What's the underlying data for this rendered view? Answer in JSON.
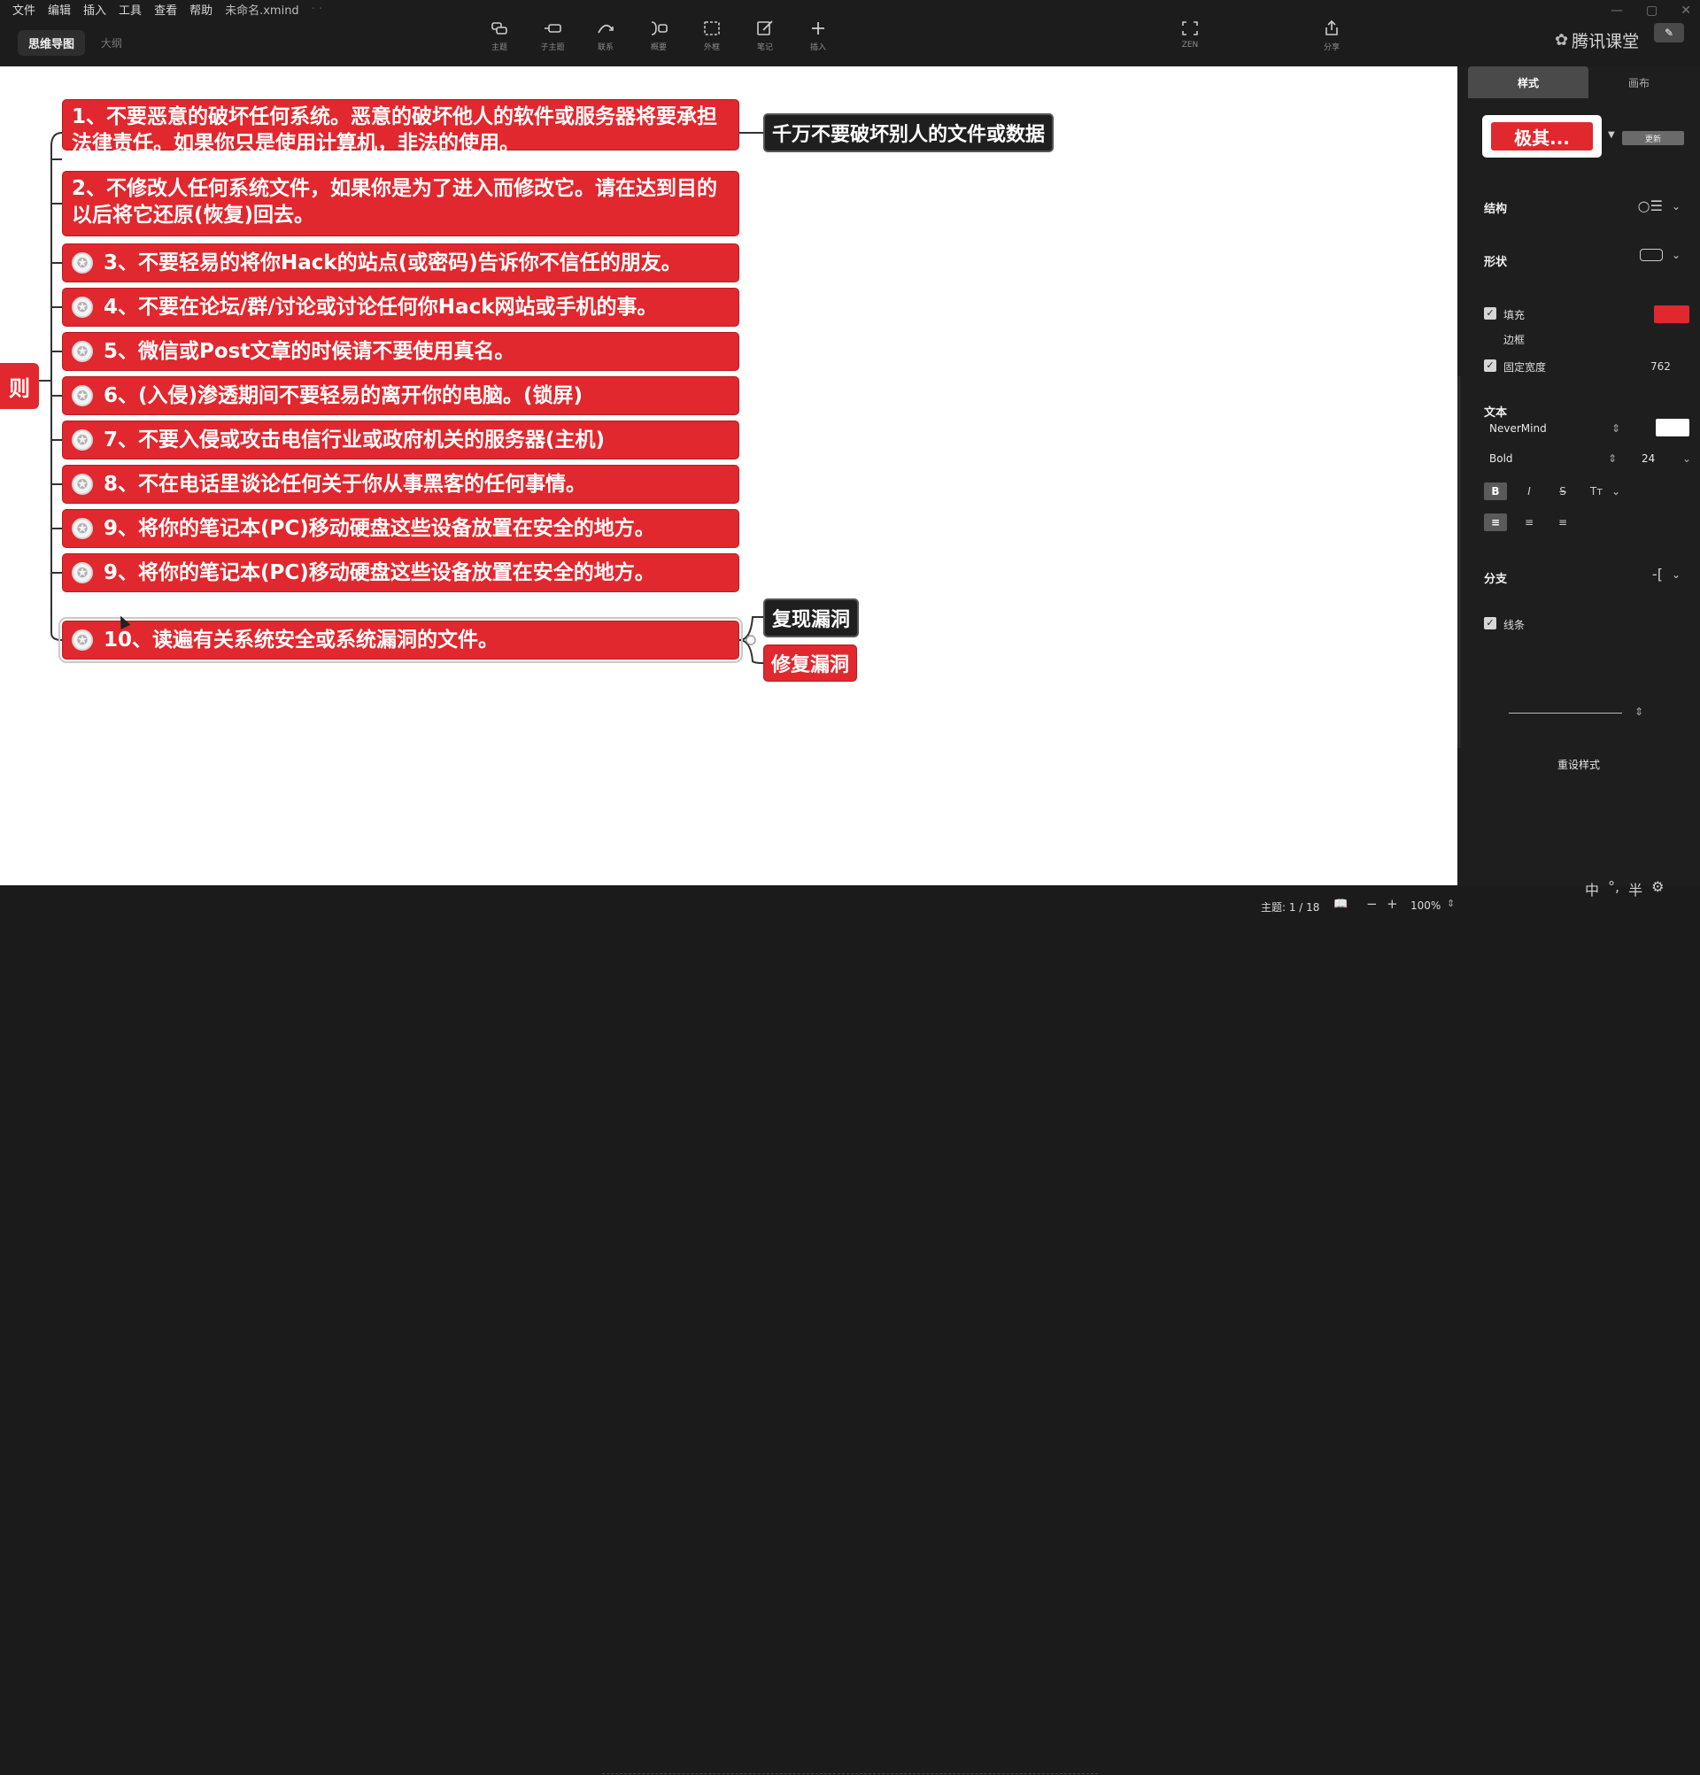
{
  "menubar": {
    "items": [
      "文件",
      "编辑",
      "插入",
      "工具",
      "查看",
      "帮助"
    ],
    "filename": "未命名.xmind",
    "extra": "· ·"
  },
  "mode": {
    "active": "思维导图",
    "outline": "大纲"
  },
  "toolbar": {
    "tools": [
      {
        "icon": "topic-icon",
        "label": "主题"
      },
      {
        "icon": "subtopic-icon",
        "label": "子主题"
      },
      {
        "icon": "relationship-icon",
        "label": "联系"
      },
      {
        "icon": "summary-icon",
        "label": "概要"
      },
      {
        "icon": "boundary-icon",
        "label": "外框"
      },
      {
        "icon": "note-icon",
        "label": "笔记"
      },
      {
        "icon": "insert-icon",
        "label": "插入"
      }
    ],
    "zen_label": "ZEN",
    "share_label": "分享"
  },
  "brand": {
    "name": "腾讯课堂"
  },
  "window": {
    "minimize": "—",
    "restore": "▢",
    "close": "✕",
    "pin": "✎"
  },
  "map": {
    "central_text": "则",
    "topics": [
      {
        "text": "1、不要恶意的破坏任何系统。恶意的破坏他人的软件或服务器将要承担法律责任。如果你只是使用计算机，非法的使用。",
        "star": false
      },
      {
        "text": "2、不修改人任何系统文件，如果你是为了进入而修改它。请在达到目的以后将它还原(恢复)回去。",
        "star": false
      },
      {
        "text": "3、不要轻易的将你Hack的站点(或密码)告诉你不信任的朋友。",
        "star": true
      },
      {
        "text": "4、不要在论坛/群/讨论或讨论任何你Hack网站或手机的事。",
        "star": true
      },
      {
        "text": "5、微信或Post文章的时候请不要使用真名。",
        "star": true
      },
      {
        "text": "6、(入侵)渗透期间不要轻易的离开你的电脑。(锁屏)",
        "star": true
      },
      {
        "text": "7、不要入侵或攻击电信行业或政府机关的服务器(主机)",
        "star": true
      },
      {
        "text": "8、不在电话里谈论任何关于你从事黑客的任何事情。",
        "star": true
      },
      {
        "text": "9、将你的笔记本(PC)移动硬盘这些设备放置在安全的地方。",
        "star": true
      },
      {
        "text": "9、将你的笔记本(PC)移动硬盘这些设备放置在安全的地方。",
        "star": true
      },
      {
        "text": "10、读遍有关系统安全或系统漏洞的文件。",
        "star": true
      }
    ],
    "callout_1": "千万不要破坏别人的文件或数据",
    "callout_2": "复现漏洞",
    "callout_3": "修复漏洞",
    "star_glyph": "✪"
  },
  "panel": {
    "tabs": {
      "style": "样式",
      "canvas": "画布"
    },
    "theme_label": "极其...",
    "update_label": "更新",
    "structure_label": "结构",
    "shape_label": "形状",
    "fill_label": "填充",
    "fill_color": "#e0282e",
    "border_label": "边框",
    "fixed_width_label": "固定宽度",
    "fixed_width_value": "762",
    "text_label": "文本",
    "font_family": "NeverMind",
    "font_weight": "Bold",
    "font_size": "24",
    "branch_label": "分支",
    "line_label": "线条",
    "reset_label": "重设样式",
    "bold_btn": "B",
    "italic_btn": "I",
    "strike_btn": "S",
    "case_btn": "Tт"
  },
  "status": {
    "topic_count": "主题: 1 / 18",
    "zoom": "100%"
  },
  "ime": {
    "lang": "中",
    "punct": "°,",
    "width": "半",
    "settings": "⚙"
  }
}
